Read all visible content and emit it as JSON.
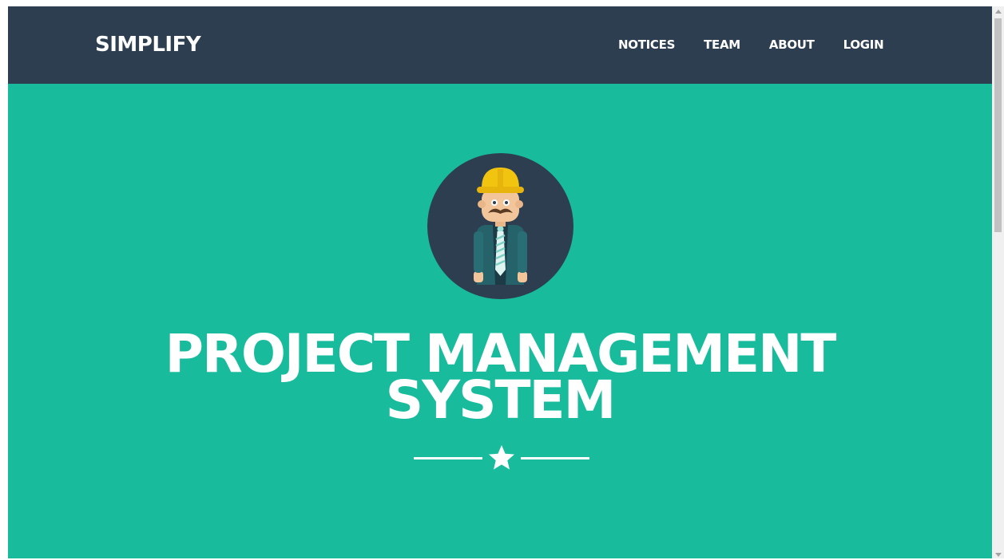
{
  "navbar": {
    "brand": "SIMPLIFY",
    "items": [
      {
        "label": "NOTICES"
      },
      {
        "label": "TEAM"
      },
      {
        "label": "ABOUT"
      },
      {
        "label": "LOGIN"
      }
    ]
  },
  "hero": {
    "title_line1": "PROJECT MANAGEMENT",
    "title_line2": "SYSTEM",
    "avatar_icon": "engineer-avatar-icon",
    "divider_icon": "star-icon"
  },
  "colors": {
    "navbar_bg": "#2c3e50",
    "hero_bg": "#18bc9c",
    "text": "#ffffff"
  }
}
